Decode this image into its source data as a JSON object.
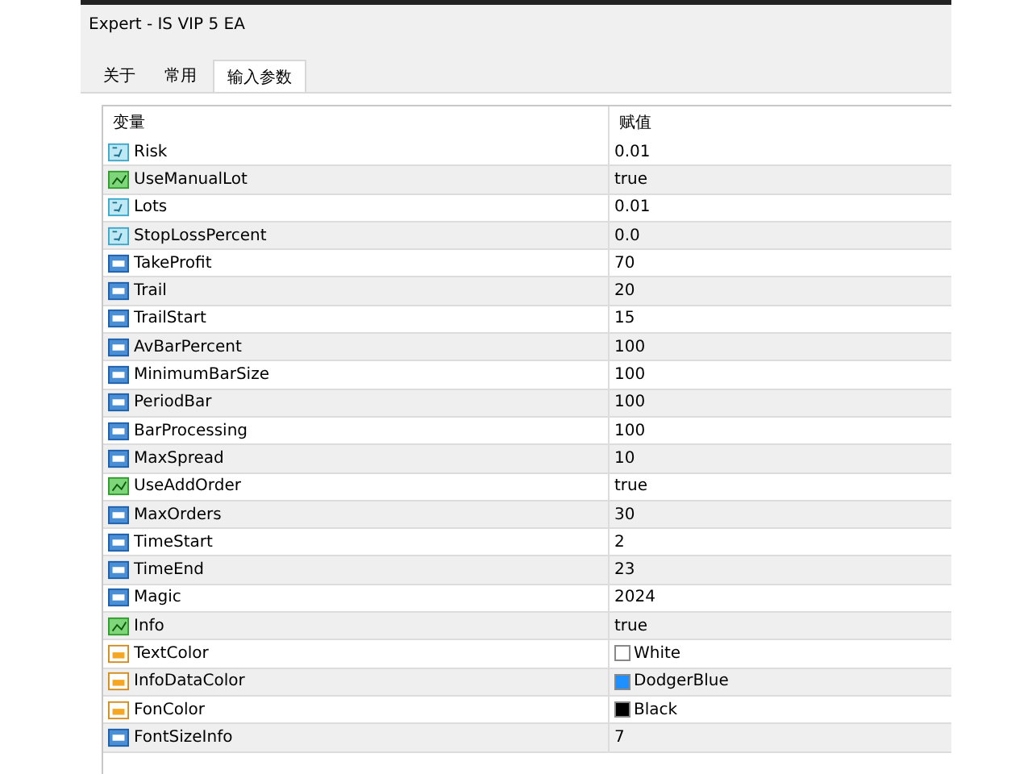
{
  "window": {
    "title": "Expert - IS VIP 5 EA"
  },
  "tabs": [
    {
      "label": "关于",
      "selected": false
    },
    {
      "label": "常用",
      "selected": false
    },
    {
      "label": "输入参数",
      "selected": true
    }
  ],
  "table": {
    "columns": [
      "变量",
      "赋值"
    ],
    "rows": [
      {
        "kind": "double",
        "name": "Risk",
        "value": "0.01"
      },
      {
        "kind": "bool",
        "name": "UseManualLot",
        "value": "true"
      },
      {
        "kind": "double",
        "name": "Lots",
        "value": "0.01"
      },
      {
        "kind": "double",
        "name": "StopLossPercent",
        "value": "0.0"
      },
      {
        "kind": "int",
        "name": "TakeProfit",
        "value": "70"
      },
      {
        "kind": "int",
        "name": "Trail",
        "value": "20"
      },
      {
        "kind": "int",
        "name": "TrailStart",
        "value": "15"
      },
      {
        "kind": "int",
        "name": "AvBarPercent",
        "value": "100"
      },
      {
        "kind": "int",
        "name": "MinimumBarSize",
        "value": "100"
      },
      {
        "kind": "int",
        "name": "PeriodBar",
        "value": "100"
      },
      {
        "kind": "int",
        "name": "BarProcessing",
        "value": "100"
      },
      {
        "kind": "int",
        "name": "MaxSpread",
        "value": "10"
      },
      {
        "kind": "bool",
        "name": "UseAddOrder",
        "value": "true"
      },
      {
        "kind": "int",
        "name": "MaxOrders",
        "value": "30"
      },
      {
        "kind": "int",
        "name": "TimeStart",
        "value": "2"
      },
      {
        "kind": "int",
        "name": "TimeEnd",
        "value": "23"
      },
      {
        "kind": "int",
        "name": "Magic",
        "value": "2024"
      },
      {
        "kind": "bool",
        "name": "Info",
        "value": "true"
      },
      {
        "kind": "color",
        "name": "TextColor",
        "value": "White",
        "color": "#ffffff"
      },
      {
        "kind": "color",
        "name": "InfoDataColor",
        "value": "DodgerBlue",
        "color": "#1e90ff"
      },
      {
        "kind": "color",
        "name": "FonColor",
        "value": "Black",
        "color": "#000000"
      },
      {
        "kind": "int",
        "name": "FontSizeInfo",
        "value": "7"
      }
    ]
  }
}
